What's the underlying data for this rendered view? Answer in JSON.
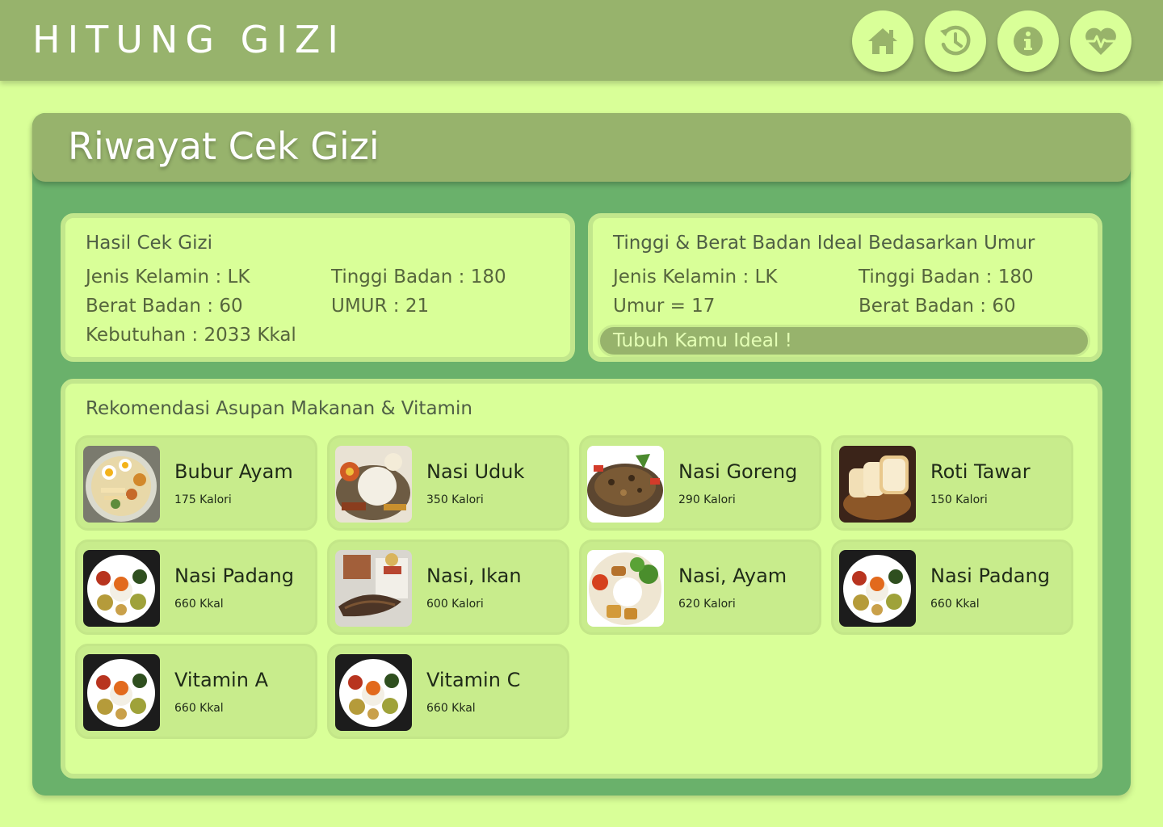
{
  "app": {
    "title": "HITUNG GIZI"
  },
  "nav": {
    "buttons": [
      {
        "icon": "home-icon"
      },
      {
        "icon": "history-icon"
      },
      {
        "icon": "info-icon"
      },
      {
        "icon": "heart-pulse-icon"
      }
    ]
  },
  "page": {
    "title": "Riwayat Cek Gizi"
  },
  "hasil": {
    "title": "Hasil Cek Gizi",
    "jenis_kelamin": "Jenis Kelamin : LK",
    "tinggi": "Tinggi Badan : 180",
    "berat": "Berat Badan :  60",
    "umur": "UMUR : 21",
    "kebutuhan": "Kebutuhan : 2033 Kkal"
  },
  "ideal": {
    "title": "Tinggi & Berat Badan Ideal Bedasarkan Umur",
    "jenis_kelamin": "Jenis Kelamin : LK",
    "tinggi": "Tinggi Badan : 180",
    "umur": "Umur = 17",
    "berat": "Berat Badan : 60",
    "status": "Tubuh Kamu Ideal !"
  },
  "rekomendasi": {
    "title": "Rekomendasi Asupan Makanan & Vitamin",
    "items": [
      {
        "name": "Bubur Ayam",
        "kalori": "175 Kalori",
        "image": "bubur-ayam-photo"
      },
      {
        "name": "Nasi Uduk",
        "kalori": "350 Kalori",
        "image": "nasi-uduk-photo"
      },
      {
        "name": "Nasi Goreng",
        "kalori": "290 Kalori",
        "image": "nasi-goreng-photo"
      },
      {
        "name": "Roti  Tawar",
        "kalori": "150 Kalori",
        "image": "roti-tawar-photo"
      },
      {
        "name": "Nasi Padang",
        "kalori": "660 Kkal",
        "image": "nasi-padang-photo"
      },
      {
        "name": "Nasi, Ikan",
        "kalori": "600 Kalori",
        "image": "nasi-ikan-photo"
      },
      {
        "name": "Nasi, Ayam",
        "kalori": "620 Kalori",
        "image": "nasi-ayam-photo"
      },
      {
        "name": "Nasi Padang",
        "kalori": "660 Kkal",
        "image": "nasi-padang-photo"
      },
      {
        "name": "Vitamin A",
        "kalori": "660 Kkal",
        "image": "nasi-padang-photo"
      },
      {
        "name": "Vitamin C",
        "kalori": "660 Kkal",
        "image": "nasi-padang-photo"
      }
    ]
  },
  "colors": {
    "background": "#d9ff98",
    "header": "#97b36c",
    "panel": "#6ab16b",
    "card": "#c8ec8c"
  }
}
